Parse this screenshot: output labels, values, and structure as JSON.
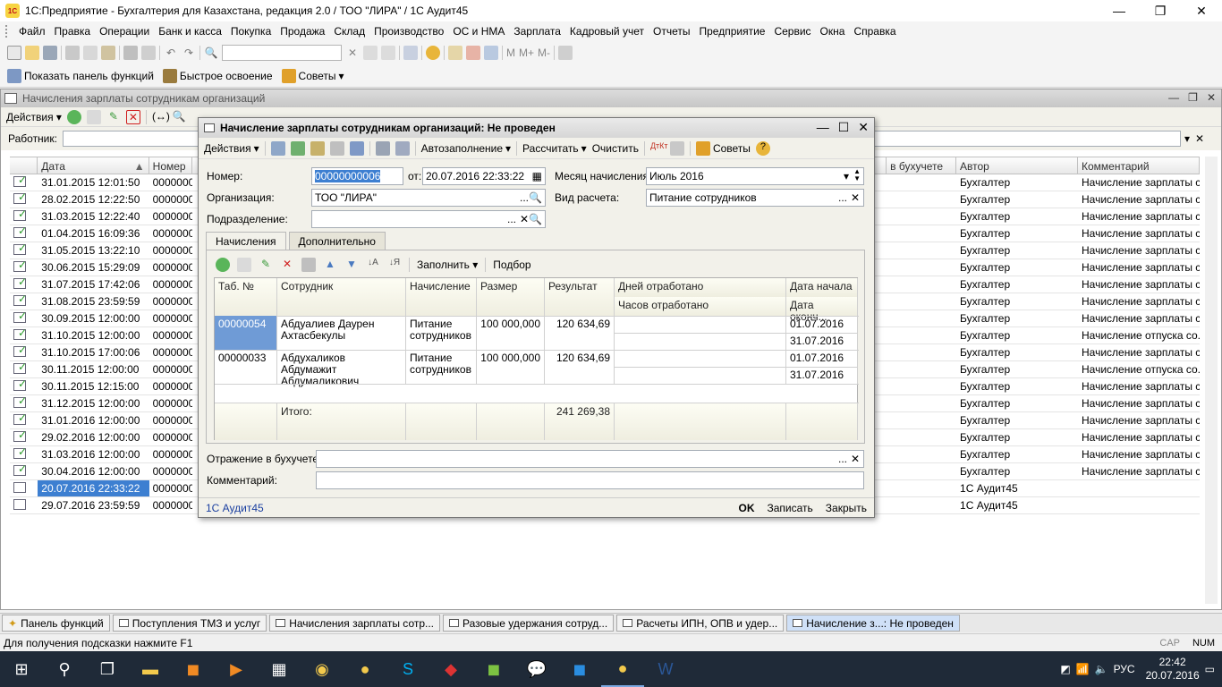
{
  "app": {
    "title": "1С:Предприятие - Бухгалтерия для Казахстана, редакция 2.0 / ТОО \"ЛИРА\" / 1С Аудит45"
  },
  "menu": [
    "Файл",
    "Правка",
    "Операции",
    "Банк и касса",
    "Покупка",
    "Продажа",
    "Склад",
    "Производство",
    "ОС и НМА",
    "Зарплата",
    "Кадровый учет",
    "Отчеты",
    "Предприятие",
    "Сервис",
    "Окна",
    "Справка"
  ],
  "toolbar2": {
    "show_panel": "Показать панель функций",
    "quick_learn": "Быстрое освоение",
    "tips": "Советы"
  },
  "list_window": {
    "title": "Начисления зарплаты сотрудникам организаций",
    "actions": "Действия",
    "worker_label": "Работник:",
    "columns": [
      "Дата",
      "Номер",
      "в бухучете",
      "Автор",
      "Комментарий"
    ],
    "rows": [
      {
        "date": "31.01.2015 12:01:50",
        "num": "0000000",
        "author": "Бухгалтер",
        "comment": "Начисление зарплаты с...",
        "icon": "ok"
      },
      {
        "date": "28.02.2015 12:22:50",
        "num": "0000000",
        "author": "Бухгалтер",
        "comment": "Начисление зарплаты с...",
        "icon": "ok"
      },
      {
        "date": "31.03.2015 12:22:40",
        "num": "0000000",
        "author": "Бухгалтер",
        "comment": "Начисление зарплаты с...",
        "icon": "ok"
      },
      {
        "date": "01.04.2015 16:09:36",
        "num": "0000000",
        "author": "Бухгалтер",
        "comment": "Начисление зарплаты с...",
        "icon": "ok"
      },
      {
        "date": "31.05.2015 13:22:10",
        "num": "0000000",
        "author": "Бухгалтер",
        "comment": "Начисление зарплаты с...",
        "icon": "ok"
      },
      {
        "date": "30.06.2015 15:29:09",
        "num": "0000000",
        "author": "Бухгалтер",
        "comment": "Начисление зарплаты с...",
        "icon": "ok"
      },
      {
        "date": "31.07.2015 17:42:06",
        "num": "0000000",
        "author": "Бухгалтер",
        "comment": "Начисление зарплаты с...",
        "icon": "ok"
      },
      {
        "date": "31.08.2015 23:59:59",
        "num": "0000000",
        "author": "Бухгалтер",
        "comment": "Начисление зарплаты с...",
        "icon": "ok"
      },
      {
        "date": "30.09.2015 12:00:00",
        "num": "0000000",
        "author": "Бухгалтер",
        "comment": "Начисление зарплаты с...",
        "icon": "ok"
      },
      {
        "date": "31.10.2015 12:00:00",
        "num": "0000000",
        "author": "Бухгалтер",
        "comment": "Начисление отпуска со...",
        "icon": "ok"
      },
      {
        "date": "31.10.2015 17:00:06",
        "num": "0000000",
        "author": "Бухгалтер",
        "comment": "Начисление зарплаты с...",
        "icon": "ok"
      },
      {
        "date": "30.11.2015 12:00:00",
        "num": "0000000",
        "author": "Бухгалтер",
        "comment": "Начисление отпуска со...",
        "icon": "ok"
      },
      {
        "date": "30.11.2015 12:15:00",
        "num": "0000000",
        "author": "Бухгалтер",
        "comment": "Начисление зарплаты с...",
        "icon": "ok"
      },
      {
        "date": "31.12.2015 12:00:00",
        "num": "0000000",
        "author": "Бухгалтер",
        "comment": "Начисление зарплаты с...",
        "icon": "ok"
      },
      {
        "date": "31.01.2016 12:00:00",
        "num": "0000000",
        "author": "Бухгалтер",
        "comment": "Начисление зарплаты с...",
        "icon": "ok"
      },
      {
        "date": "29.02.2016 12:00:00",
        "num": "0000000",
        "author": "Бухгалтер",
        "comment": "Начисление зарплаты с...",
        "icon": "ok"
      },
      {
        "date": "31.03.2016 12:00:00",
        "num": "0000000",
        "author": "Бухгалтер",
        "comment": "Начисление зарплаты с...",
        "icon": "ok"
      },
      {
        "date": "30.04.2016 12:00:00",
        "num": "0000000",
        "author": "Бухгалтер",
        "comment": "Начисление зарплаты с...",
        "icon": "ok"
      },
      {
        "date": "20.07.2016 22:33:22",
        "num": "0000000",
        "author": "1С Аудит45",
        "comment": "",
        "icon": "plain",
        "selected": true
      },
      {
        "date": "29.07.2016 23:59:59",
        "num": "0000000",
        "author": "1С Аудит45",
        "comment": "",
        "icon": "plain"
      }
    ]
  },
  "dialog": {
    "title": "Начисление зарплаты сотрудникам организаций: Не проведен",
    "toolbar": {
      "actions": "Действия",
      "autofill": "Автозаполнение",
      "calculate": "Рассчитать",
      "clear": "Очистить",
      "tips": "Советы"
    },
    "number_label": "Номер:",
    "number_value": "00000000006",
    "from_label": "от:",
    "date_value": "20.07.2016 22:33:22",
    "month_label": "Месяц начисления:",
    "month_value": "Июль 2016",
    "org_label": "Организация:",
    "org_value": "ТОО \"ЛИРА\"",
    "calc_type_label": "Вид расчета:",
    "calc_type_value": "Питание сотрудников",
    "dept_label": "Подразделение:",
    "dept_value": "",
    "tabs": [
      "Начисления",
      "Дополнительно"
    ],
    "fill_btn": "Заполнить",
    "select_btn": "Подбор",
    "grid_headers": {
      "tab": "Таб. №",
      "employee": "Сотрудник",
      "accrual": "Начисление",
      "size": "Размер",
      "result": "Результат",
      "days": "Дней отработано",
      "hours": "Часов отработано",
      "date_start": "Дата начала",
      "date_end": "Дата оконч..."
    },
    "rows": [
      {
        "tab": "00000054",
        "employee": "Абдуалиев Даурен Ахтасбекулы",
        "accrual": "Питание сотрудников",
        "size": "100 000,000",
        "result": "120 634,69",
        "start": "01.07.2016",
        "end": "31.07.2016"
      },
      {
        "tab": "00000033",
        "employee": "Абдухаликов Абдумажит Абдумаликович",
        "accrual": "Питание сотрудников",
        "size": "100 000,000",
        "result": "120 634,69",
        "start": "01.07.2016",
        "end": "31.07.2016"
      }
    ],
    "total_label": "Итого:",
    "total_value": "241 269,38",
    "reflect_label": "Отражение в бухучете:",
    "reflect_value": "",
    "comment_label": "Комментарий:",
    "comment_value": "",
    "author": "1С Аудит45",
    "ok": "OK",
    "save": "Записать",
    "close": "Закрыть"
  },
  "window_tabs": [
    {
      "label": "Панель функций"
    },
    {
      "label": "Поступления ТМЗ и услуг"
    },
    {
      "label": "Начисления зарплаты сотр..."
    },
    {
      "label": "Разовые удержания сотруд..."
    },
    {
      "label": "Расчеты ИПН, ОПВ и удер..."
    },
    {
      "label": "Начисление з...: Не проведен",
      "active": true
    }
  ],
  "status": {
    "hint": "Для получения подсказки нажмите F1",
    "cap": "CAP",
    "num": "NUM"
  },
  "taskbar": {
    "lang": "РУС",
    "time": "22:42",
    "date": "20.07.2016"
  }
}
